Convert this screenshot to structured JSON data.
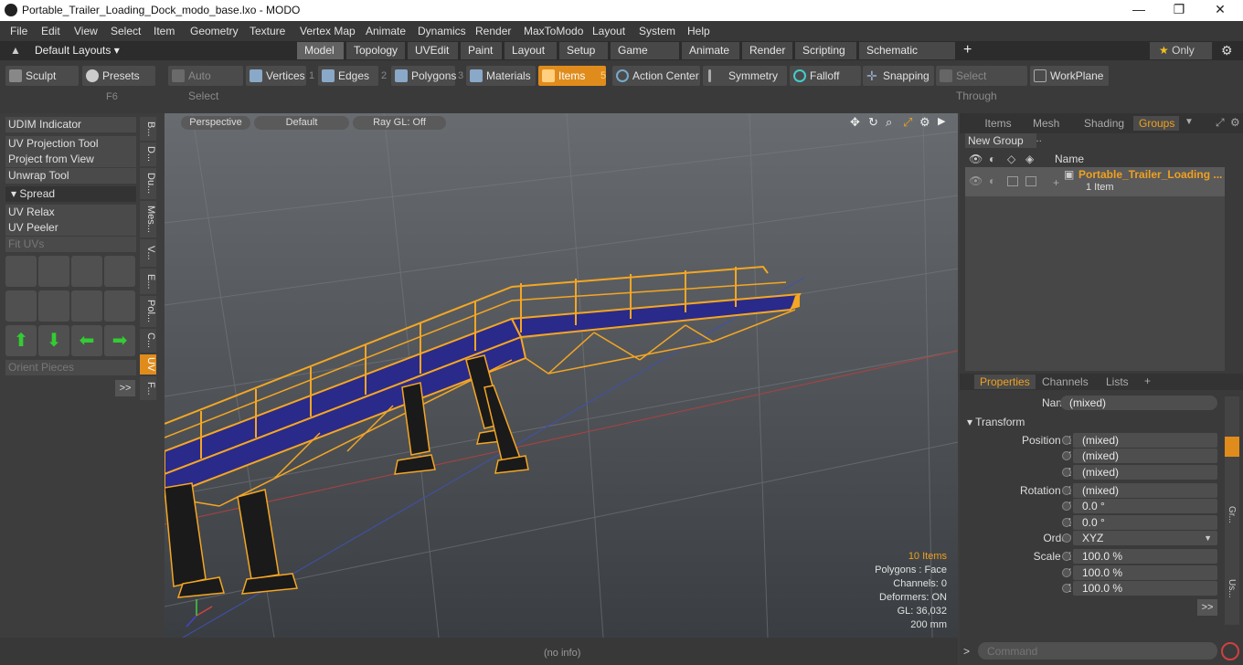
{
  "window": {
    "title": "Portable_Trailer_Loading_Dock_modo_base.lxo - MODO",
    "controls": [
      "—",
      "❐",
      "✕"
    ]
  },
  "menu": [
    "File",
    "Edit",
    "View",
    "Select",
    "Item",
    "Geometry",
    "Texture",
    "Vertex Map",
    "Animate",
    "Dynamics",
    "Render",
    "MaxToModo",
    "Layout",
    "System",
    "Help"
  ],
  "layout_selector": "Default Layouts",
  "tabs": [
    "Model",
    "Topology",
    "UVEdit",
    "Paint",
    "Layout",
    "Setup",
    "Game Tools",
    "Animate",
    "Render",
    "Scripting",
    "Schematic Fusion"
  ],
  "tab_add": "+",
  "only_label": "Only",
  "toolbar": {
    "sculpt": "Sculpt",
    "presets": "Presets",
    "presets_key": "F6",
    "auto_select": "Auto Select",
    "vertices": "Vertices",
    "vertices_num": "1",
    "edges": "Edges",
    "edges_num": "2",
    "polygons": "Polygons",
    "polygons_num": "3",
    "materials": "Materials",
    "items": "Items",
    "items_num": "5",
    "action_center": "Action Center",
    "symmetry": "Symmetry",
    "falloff": "Falloff",
    "snapping": "Snapping",
    "select_through": "Select Through",
    "workplane": "WorkPlane"
  },
  "left_panel": {
    "tools": [
      "UDIM Indicator",
      "UV Projection Tool",
      "Project from View",
      "Unwrap Tool"
    ],
    "spread": "Spread",
    "tools2": [
      "UV Relax",
      "UV Peeler"
    ],
    "fit_uvs": "Fit UVs",
    "orient_pieces": "Orient Pieces",
    "more": ">>",
    "vtabs": [
      "B...",
      "D...",
      "Du...",
      "Mes...",
      "V...",
      "E...",
      "Pol...",
      "C...",
      "UV",
      "F..."
    ]
  },
  "viewport": {
    "perspective": "Perspective",
    "default": "Default",
    "raygl": "Ray GL: Off",
    "stats": {
      "items": "10 Items",
      "polygons": "Polygons : Face",
      "channels": "Channels: 0",
      "deformers": "Deformers: ON",
      "gl": "GL: 36,032",
      "scale": "200 mm"
    }
  },
  "status": {
    "info": "(no info)",
    "command_placeholder": "Command"
  },
  "groups_panel": {
    "tabs": [
      "Items",
      "Mesh ...",
      "Shading",
      "Groups"
    ],
    "new_group": "New Group",
    "name_header": "Name",
    "group_name": "Portable_Trailer_Loading ...",
    "group_count": "1 Item"
  },
  "properties": {
    "tabs": [
      "Properties",
      "Channels",
      "Lists"
    ],
    "name_label": "Name",
    "name_value": "(mixed)",
    "transform_label": "Transform",
    "position_label": "Position X",
    "position": [
      "(mixed)",
      "(mixed)",
      "(mixed)"
    ],
    "rotation_label": "Rotation X",
    "rotation": [
      "(mixed)",
      "0.0 °",
      "0.0 °"
    ],
    "order_label": "Order",
    "order_value": "XYZ",
    "scale_label": "Scale X",
    "scale": [
      "100.0 %",
      "100.0 %",
      "100.0 %"
    ],
    "y_label": "Y",
    "z_label": "Z",
    "more": ">>",
    "side_tabs": [
      "Gr...",
      "Us..."
    ]
  },
  "colors": {
    "accent": "#f0a020",
    "wire": "#f5a623",
    "mesh_fill": "#2a2a8a"
  }
}
